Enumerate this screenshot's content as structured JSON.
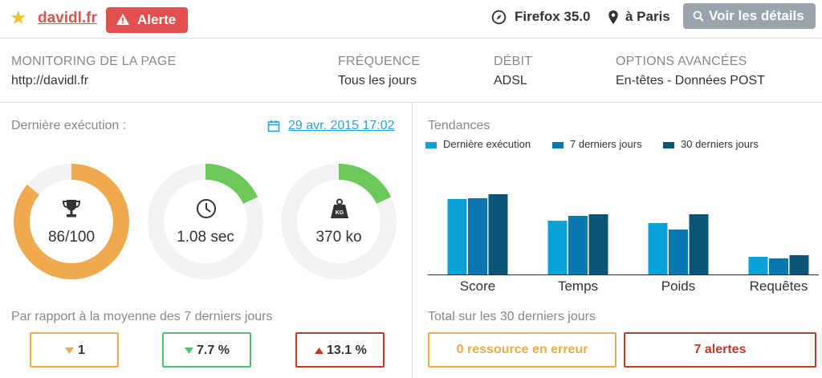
{
  "header": {
    "site_name": "davidl.fr",
    "alert_label": "Alerte",
    "browser": "Firefox 35.0",
    "location": "à Paris",
    "details_button": "Voir les détails",
    "star_color": "#f2c12e",
    "alert_color": "#e0504f"
  },
  "info": [
    {
      "key": "MONITORING DE LA PAGE",
      "value": "http://davidl.fr"
    },
    {
      "key": "FRÉQUENCE",
      "value": "Tous les jours"
    },
    {
      "key": "DÉBIT",
      "value": "ADSL"
    },
    {
      "key": "OPTIONS AVANCÉES",
      "value": "En-têtes - Données POST"
    }
  ],
  "last_execution": {
    "label": "Dernière exécution :",
    "date": "29 avr. 2015 17:02"
  },
  "gauges": [
    {
      "icon": "trophy-icon",
      "value": "86/100",
      "fraction": 0.86,
      "color": "#eeaa4d"
    },
    {
      "icon": "clock-icon",
      "value": "1.08 sec",
      "fraction": 0.18,
      "color": "#6cc85a"
    },
    {
      "icon": "weight-icon",
      "value": "370 ko",
      "fraction": 0.18,
      "color": "#6cc85a",
      "icon_text": "KG"
    }
  ],
  "comparison": {
    "label": "Par rapport à la moyenne des 7 derniers jours",
    "items": [
      {
        "value": "1",
        "direction": "down",
        "color": "#eeaa4d",
        "arrow_color": "#eeaa4d"
      },
      {
        "value": "7.7 %",
        "direction": "down",
        "color": "#4cc36a",
        "arrow_color": "#4cc36a"
      },
      {
        "value": "13.1 %",
        "direction": "up",
        "color": "#c0392b",
        "arrow_color": "#c0392b"
      }
    ]
  },
  "trends": {
    "title": "Tendances",
    "total_label": "Total sur les 30 derniers jours",
    "total_errors": "0 ressource en erreur",
    "total_alerts": "7 alertes",
    "errors_color": "#eeaa4d",
    "alerts_color": "#c0392b"
  },
  "chart_data": {
    "type": "bar",
    "title": "Tendances",
    "categories": [
      "Score",
      "Temps",
      "Poids",
      "Requêtes"
    ],
    "series": [
      {
        "name": "Dernière exécution",
        "color": "#0aa0d8",
        "values": [
          94,
          67,
          64,
          22
        ]
      },
      {
        "name": "7 derniers jours",
        "color": "#0a78b0",
        "values": [
          95,
          73,
          56,
          20
        ]
      },
      {
        "name": "30 derniers jours",
        "color": "#0a5478",
        "values": [
          100,
          75,
          75,
          24
        ]
      }
    ],
    "ylim": [
      0,
      100
    ],
    "legend": "top",
    "grid": false
  }
}
